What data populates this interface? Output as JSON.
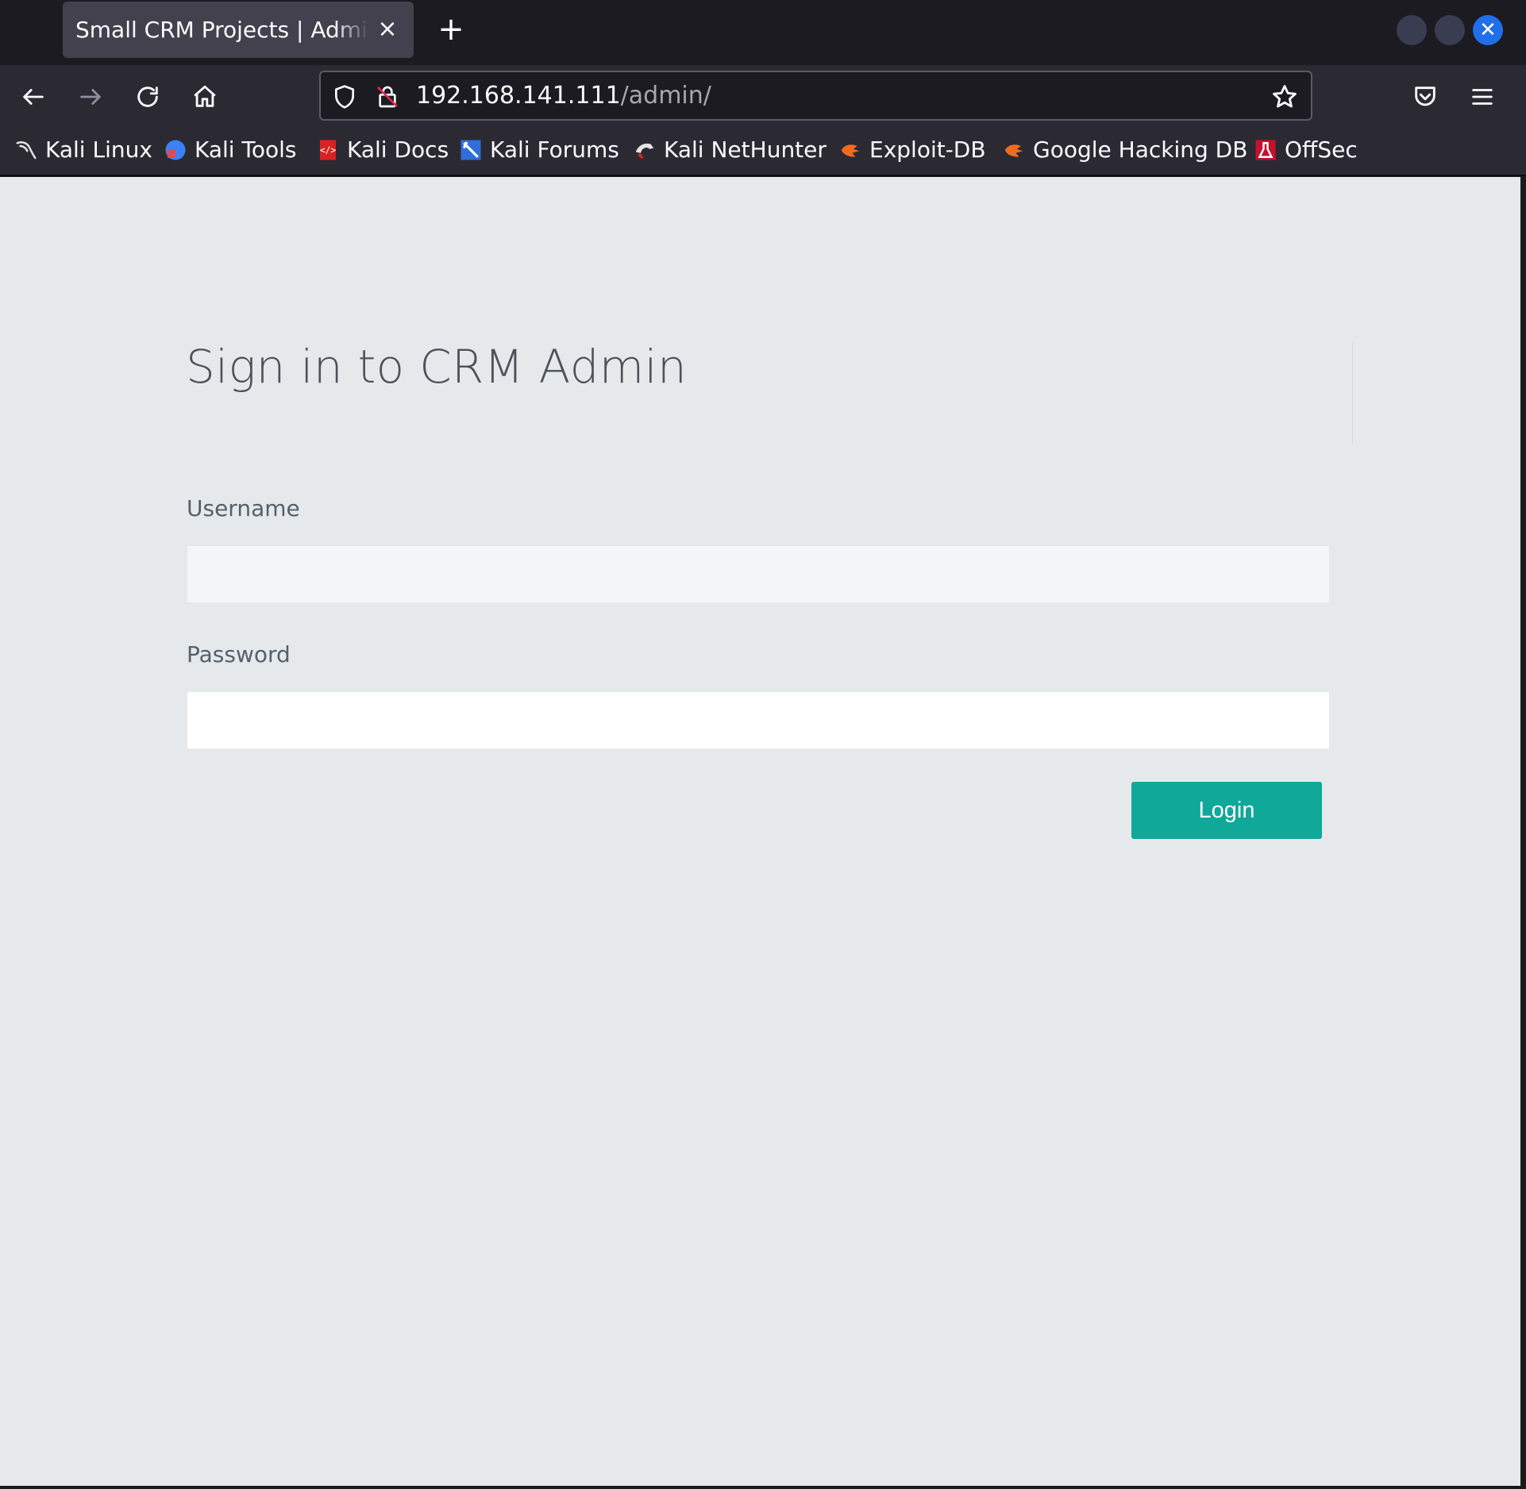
{
  "browser": {
    "tab_title": "Small CRM Projects | Admin Login",
    "url_host": "192.168.141.111",
    "url_path": "/admin/",
    "icons": {
      "tab_close": "close-icon",
      "new_tab": "plus-icon",
      "back": "arrow-left-icon",
      "forward": "arrow-right-icon",
      "reload": "reload-icon",
      "home": "home-icon",
      "tracking": "shield-icon",
      "insecure": "insecure-lock-icon",
      "bookmark_star": "star-icon",
      "pocket": "pocket-icon",
      "menu": "hamburger-menu-icon"
    },
    "colors": {
      "tabbar": "#1c1b22",
      "toolbar": "#2b2a33",
      "close_button": "#1f6feb"
    }
  },
  "bookmarks": [
    {
      "label": "Kali Linux",
      "icon": "kali-dragon-icon"
    },
    {
      "label": "Kali Tools",
      "icon": "kali-tools-icon"
    },
    {
      "label": "Kali Docs",
      "icon": "kali-docs-icon"
    },
    {
      "label": "Kali Forums",
      "icon": "kali-forums-icon"
    },
    {
      "label": "Kali NetHunter",
      "icon": "nethunter-icon"
    },
    {
      "label": "Exploit-DB",
      "icon": "exploit-db-icon"
    },
    {
      "label": "Google Hacking DB",
      "icon": "ghdb-icon"
    },
    {
      "label": "OffSec",
      "icon": "offsec-icon"
    }
  ],
  "page": {
    "heading": "Sign in to CRM Admin",
    "username_label": "Username",
    "username_value": "",
    "password_label": "Password",
    "password_value": "",
    "login_button": "Login",
    "colors": {
      "background": "#e5e9ec",
      "button": "#10a898",
      "heading_text": "#4c5259"
    }
  }
}
